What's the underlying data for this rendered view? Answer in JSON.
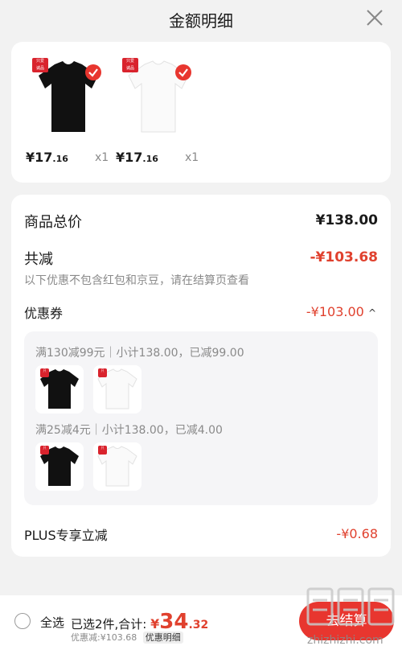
{
  "header": {
    "title": "金额明细"
  },
  "products": [
    {
      "badge": "只爱\n诚品",
      "price_symbol": "¥",
      "price_int": "17",
      "price_dec": ".16",
      "qty": "x1",
      "color": "#111111"
    },
    {
      "badge": "只爱\n诚品",
      "price_symbol": "¥",
      "price_int": "17",
      "price_dec": ".16",
      "qty": "x1",
      "color": "#ffffff"
    }
  ],
  "detail": {
    "total_label": "商品总价",
    "total_value": "¥138.00",
    "discount_label": "共减",
    "discount_value": "-¥103.68",
    "discount_note": "以下优惠不包含红包和京豆，请在结算页查看",
    "coupon_label": "优惠券",
    "coupon_value": "-¥103.00",
    "coupon_caret": "^",
    "coupons": [
      {
        "text": "满130减99元｜小计138.00，已减99.00"
      },
      {
        "text": "满25减4元｜小计138.00，已减4.00"
      }
    ],
    "plus_label": "PLUS专享立减",
    "plus_value": "-¥0.68"
  },
  "bottom": {
    "select_all": "全选",
    "selected_prefix": "已选2件,合计:",
    "total_symbol": "¥",
    "total_int": "34",
    "total_dec": ".32",
    "discount_note": "优惠减:¥103.68",
    "detail_link": "优惠明细",
    "checkout": "去结算",
    "watermark": "zhizhizhi.com"
  },
  "colors": {
    "accent": "#e0412e",
    "checkout": "#e8362f"
  }
}
